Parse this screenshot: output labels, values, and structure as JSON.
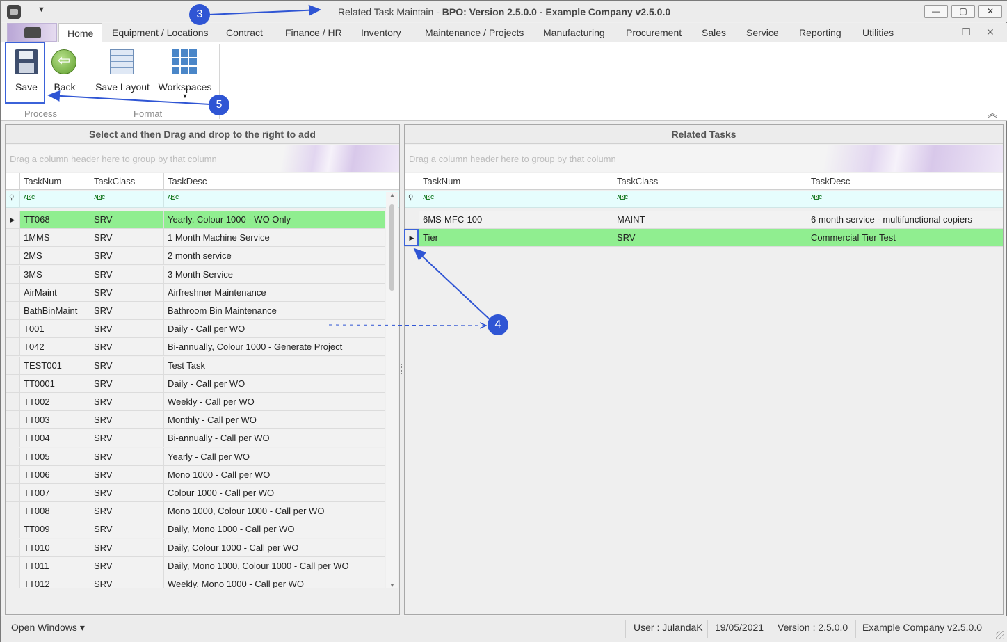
{
  "window": {
    "title_prefix": "Related Task Maintain",
    "title_sep": " - ",
    "title_app": "BPO: Version 2.5.0.0 - Example Company v2.5.0.0",
    "qat_caret": "▼",
    "minimize": "—",
    "maximize": "▢",
    "close": "✕"
  },
  "ribbon": {
    "tabs": [
      "Home",
      "Equipment / Locations",
      "Contract",
      "Finance / HR",
      "Inventory",
      "Maintenance / Projects",
      "Manufacturing",
      "Procurement",
      "Sales",
      "Service",
      "Reporting",
      "Utilities"
    ],
    "mdi_minimize": "—",
    "mdi_restore": "❐",
    "mdi_close": "✕",
    "buttons": {
      "save": "Save",
      "back": "Back",
      "save_layout": "Save Layout",
      "workspaces": "Workspaces",
      "workspaces_caret": "▼"
    },
    "groups": {
      "process": "Process",
      "format": "Format"
    },
    "collapse": "︽"
  },
  "left_panel": {
    "title": "Select and then Drag and drop to the right to add",
    "group_hint": "Drag a column header here to group by that column",
    "columns": [
      "TaskNum",
      "TaskClass",
      "TaskDesc"
    ],
    "rows": [
      [
        "TT068",
        "SRV",
        "Yearly, Colour 1000 - WO Only"
      ],
      [
        "1MMS",
        "SRV",
        "1 Month Machine Service"
      ],
      [
        "2MS",
        "SRV",
        "2 month service"
      ],
      [
        "3MS",
        "SRV",
        "3 Month Service"
      ],
      [
        "AirMaint",
        "SRV",
        "Airfreshner Maintenance"
      ],
      [
        "BathBinMaint",
        "SRV",
        "Bathroom Bin Maintenance"
      ],
      [
        "T001",
        "SRV",
        "Daily - Call per WO"
      ],
      [
        "T042",
        "SRV",
        "Bi-annually, Colour 1000 - Generate Project"
      ],
      [
        "TEST001",
        "SRV",
        "Test Task"
      ],
      [
        "TT0001",
        "SRV",
        "Daily - Call per WO"
      ],
      [
        "TT002",
        "SRV",
        "Weekly - Call per WO"
      ],
      [
        "TT003",
        "SRV",
        " Monthly - Call per WO"
      ],
      [
        "TT004",
        "SRV",
        "Bi-annually - Call per WO"
      ],
      [
        "TT005",
        "SRV",
        "Yearly - Call per WO"
      ],
      [
        "TT006",
        "SRV",
        "Mono 1000 - Call per WO"
      ],
      [
        "TT007",
        "SRV",
        "Colour 1000 - Call per WO"
      ],
      [
        "TT008",
        "SRV",
        "Mono 1000, Colour 1000 - Call per WO"
      ],
      [
        "TT009",
        "SRV",
        "Daily, Mono 1000 - Call per WO"
      ],
      [
        "TT010",
        "SRV",
        "Daily, Colour 1000 - Call per WO"
      ],
      [
        "TT011",
        "SRV",
        "Daily, Mono 1000, Colour 1000 - Call per WO"
      ],
      [
        "TT012",
        "SRV",
        "Weekly, Mono 1000 - Call per WO"
      ]
    ],
    "selected_row": 0
  },
  "right_panel": {
    "title": "Related Tasks",
    "group_hint": "Drag a column header here to group by that column",
    "columns": [
      "TaskNum",
      "TaskClass",
      "TaskDesc"
    ],
    "rows": [
      [
        "6MS-MFC-100",
        "MAINT",
        "6 month service - multifunctional copiers"
      ],
      [
        "Tier",
        "SRV",
        "Commercial Tier Test"
      ]
    ],
    "selected_row": 1
  },
  "statusbar": {
    "open_windows": "Open Windows ▾",
    "user": "User : JulandaK",
    "date": "19/05/2021",
    "version": "Version : 2.5.0.0",
    "company": "Example Company v2.5.0.0"
  },
  "annotations": {
    "a3": "3",
    "a4": "4",
    "a5": "5"
  },
  "colors": {
    "selected_row": "#90ee90",
    "annotation": "#2f55d4",
    "filter_row": "#e6fdfd"
  }
}
